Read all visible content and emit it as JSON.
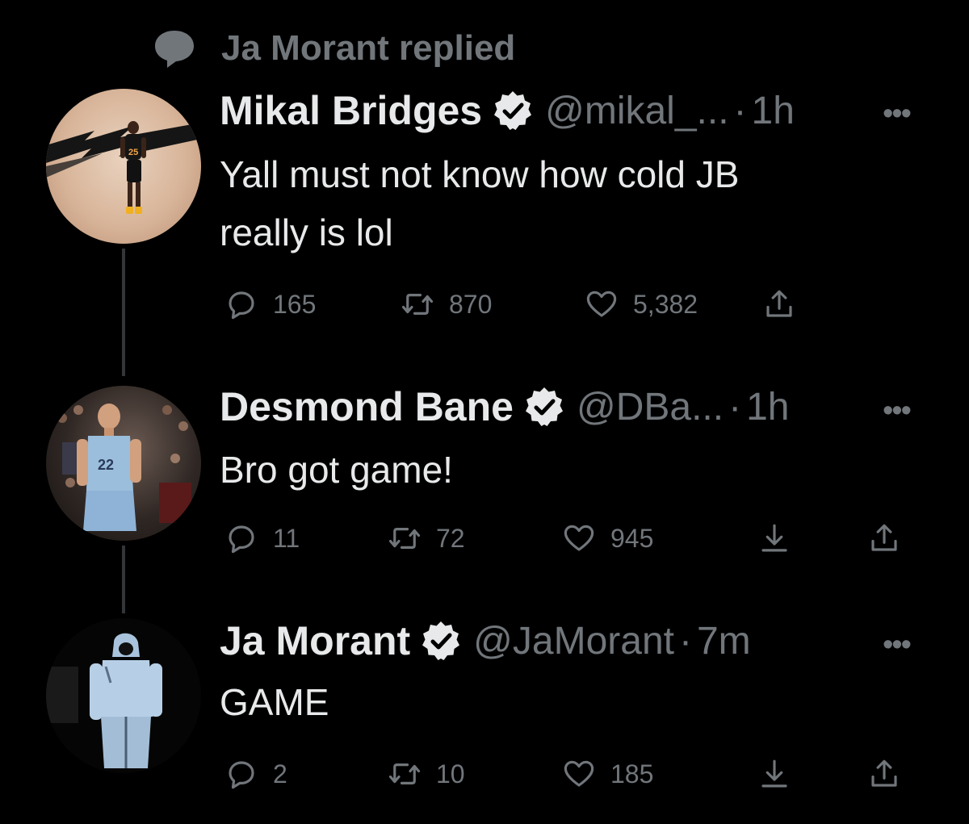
{
  "context": {
    "icon": "reply-bubble-icon",
    "text": "Ja Morant replied"
  },
  "colors": {
    "background": "#000000",
    "text": "#e7e9ea",
    "muted": "#71767b",
    "line": "#333639"
  },
  "tweets": [
    {
      "name": "Mikal Bridges",
      "handle": "@mikal_...",
      "time": "1h",
      "text_lines": [
        "Yall must not know how cold JB",
        "really is lol"
      ],
      "replies": "165",
      "retweets": "870",
      "likes": "5,382",
      "jersey": "25"
    },
    {
      "name": "Desmond Bane",
      "handle": "@DBa...",
      "time": "1h",
      "text_lines": [
        "Bro got game!"
      ],
      "replies": "11",
      "retweets": "72",
      "likes": "945",
      "jersey": "22"
    },
    {
      "name": "Ja Morant",
      "handle": "@JaMorant",
      "time": "7m",
      "text_lines": [
        "GAME"
      ],
      "replies": "2",
      "retweets": "10",
      "likes": "185"
    }
  ],
  "separator": "·",
  "more_label": "•••"
}
